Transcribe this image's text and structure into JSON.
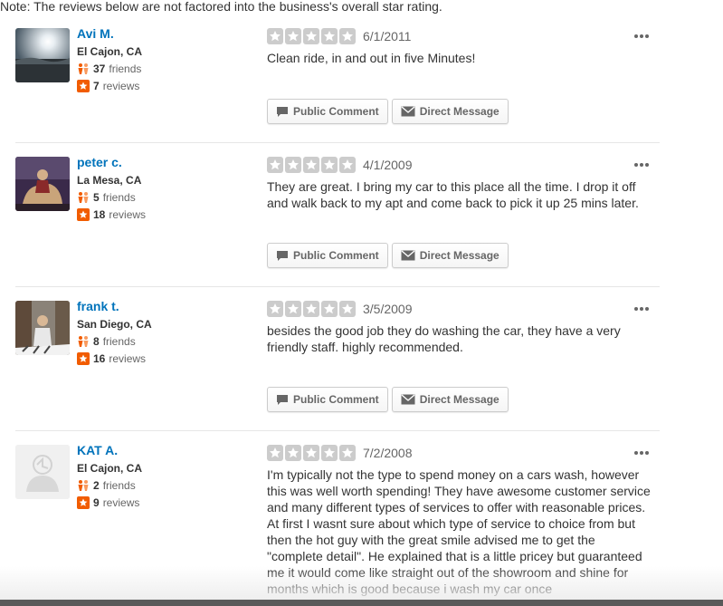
{
  "note": "Note: The reviews below are not factored into the business's overall star rating.",
  "buttons": {
    "public_comment": "Public Comment",
    "direct_message": "Direct Message"
  },
  "colors": {
    "link": "#0073bb",
    "star_empty": "#cccccc",
    "friends_icon": "#f15c00",
    "reviews_icon": "#f15c00"
  },
  "reviews": [
    {
      "user": {
        "name": "Avi M.",
        "location": "El Cajon, CA",
        "friends_count": "37",
        "friends_label": "friends",
        "reviews_count": "7",
        "reviews_label": "reviews"
      },
      "rating": 0,
      "date": "6/1/2011",
      "text": "Clean ride, in and out in five Minutes!"
    },
    {
      "user": {
        "name": "peter c.",
        "location": "La Mesa, CA",
        "friends_count": "5",
        "friends_label": "friends",
        "reviews_count": "18",
        "reviews_label": "reviews"
      },
      "rating": 0,
      "date": "4/1/2009",
      "text": "They are great. I bring my car to this place all the time. I drop it off and walk back to my apt and come back to pick it up 25 mins later."
    },
    {
      "user": {
        "name": "frank t.",
        "location": "San Diego, CA",
        "friends_count": "8",
        "friends_label": "friends",
        "reviews_count": "16",
        "reviews_label": "reviews"
      },
      "rating": 0,
      "date": "3/5/2009",
      "text": "besides the good job they do washing the car, they have a very friendly staff. highly recommended."
    },
    {
      "user": {
        "name": "KAT A.",
        "location": "El Cajon, CA",
        "friends_count": "2",
        "friends_label": "friends",
        "reviews_count": "9",
        "reviews_label": "reviews"
      },
      "rating": 0,
      "date": "7/2/2008",
      "text": "I'm typically not the type to spend money on a cars wash, however this was well worth spending! They have awesome customer service and many different types of services to offer with reasonable prices. At first I wasnt sure about which type of  service to choice from but then the hot guy  with the great smile advised me to get the \"complete detail\". He explained that is  a little pricey but guaranteed me it would come like straight out of the showroom and shine for  months which is good because i wash my car once"
    }
  ]
}
